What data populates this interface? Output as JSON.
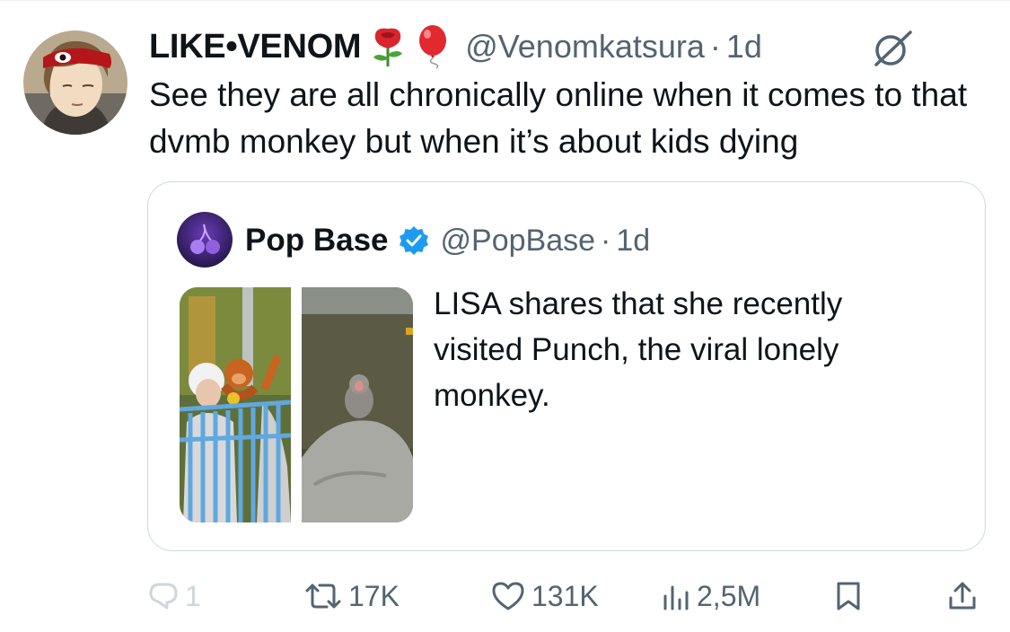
{
  "tweet": {
    "display_name": "LIKE•VENOM",
    "handle": "@Venomkatsura",
    "separator": "·",
    "time": "1d",
    "text": "See they are all chronically online when it comes to that dvmb monkey but when it’s about kids dying",
    "emojis": [
      "rose-emoji",
      "balloon-emoji"
    ],
    "grok_icon": "grok-icon"
  },
  "quote": {
    "display_name": "Pop Base",
    "verified": true,
    "handle": "@PopBase",
    "separator": "·",
    "time": "1d",
    "text": "LISA shares that she recently visited Punch, the viral lonely monkey.",
    "media": [
      "photo-woman-with-orangutan-plush",
      "photo-monkey-on-rock"
    ]
  },
  "actions": {
    "replies": "1",
    "retweets": "17K",
    "likes": "131K",
    "views": "2,5M"
  },
  "colors": {
    "text": "#0f1419",
    "secondary": "#536471",
    "border": "#cfd9de",
    "verified": "#1d9bf0"
  }
}
